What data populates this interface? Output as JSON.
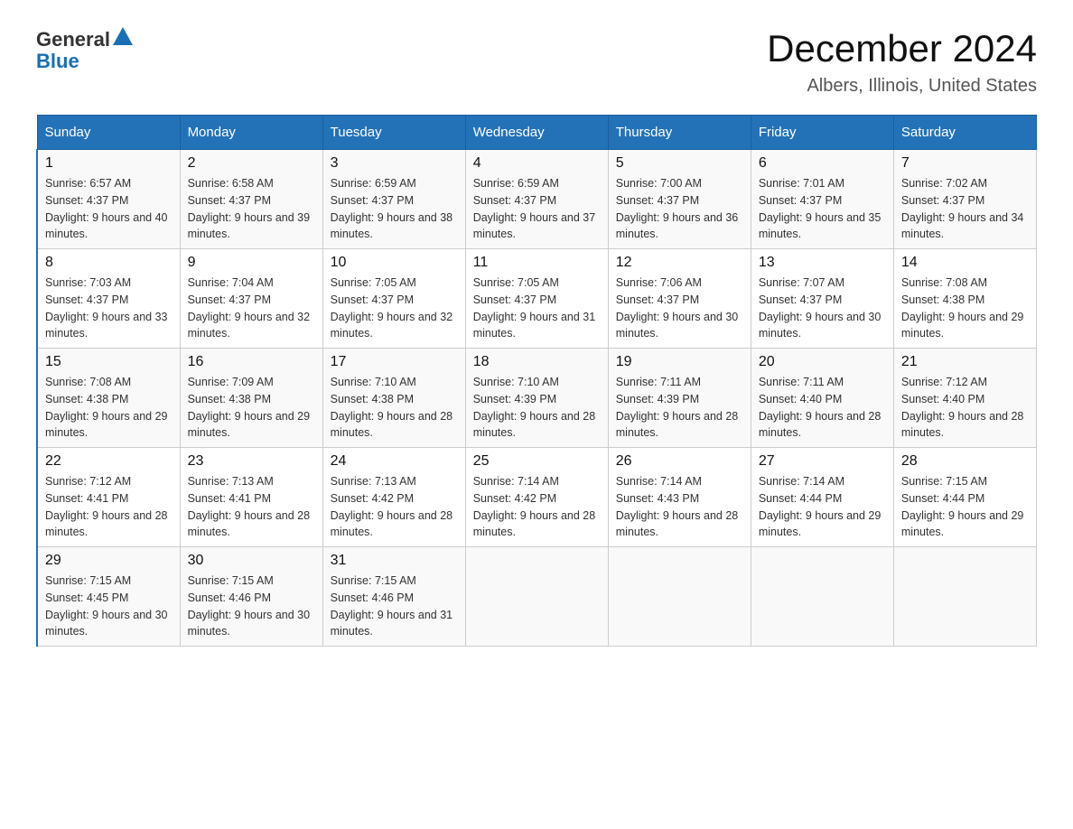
{
  "logo": {
    "text_general": "General",
    "text_blue": "Blue"
  },
  "header": {
    "title": "December 2024",
    "subtitle": "Albers, Illinois, United States"
  },
  "days_of_week": [
    "Sunday",
    "Monday",
    "Tuesday",
    "Wednesday",
    "Thursday",
    "Friday",
    "Saturday"
  ],
  "weeks": [
    [
      {
        "day": "1",
        "sunrise": "6:57 AM",
        "sunset": "4:37 PM",
        "daylight": "9 hours and 40 minutes."
      },
      {
        "day": "2",
        "sunrise": "6:58 AM",
        "sunset": "4:37 PM",
        "daylight": "9 hours and 39 minutes."
      },
      {
        "day": "3",
        "sunrise": "6:59 AM",
        "sunset": "4:37 PM",
        "daylight": "9 hours and 38 minutes."
      },
      {
        "day": "4",
        "sunrise": "6:59 AM",
        "sunset": "4:37 PM",
        "daylight": "9 hours and 37 minutes."
      },
      {
        "day": "5",
        "sunrise": "7:00 AM",
        "sunset": "4:37 PM",
        "daylight": "9 hours and 36 minutes."
      },
      {
        "day": "6",
        "sunrise": "7:01 AM",
        "sunset": "4:37 PM",
        "daylight": "9 hours and 35 minutes."
      },
      {
        "day": "7",
        "sunrise": "7:02 AM",
        "sunset": "4:37 PM",
        "daylight": "9 hours and 34 minutes."
      }
    ],
    [
      {
        "day": "8",
        "sunrise": "7:03 AM",
        "sunset": "4:37 PM",
        "daylight": "9 hours and 33 minutes."
      },
      {
        "day": "9",
        "sunrise": "7:04 AM",
        "sunset": "4:37 PM",
        "daylight": "9 hours and 32 minutes."
      },
      {
        "day": "10",
        "sunrise": "7:05 AM",
        "sunset": "4:37 PM",
        "daylight": "9 hours and 32 minutes."
      },
      {
        "day": "11",
        "sunrise": "7:05 AM",
        "sunset": "4:37 PM",
        "daylight": "9 hours and 31 minutes."
      },
      {
        "day": "12",
        "sunrise": "7:06 AM",
        "sunset": "4:37 PM",
        "daylight": "9 hours and 30 minutes."
      },
      {
        "day": "13",
        "sunrise": "7:07 AM",
        "sunset": "4:37 PM",
        "daylight": "9 hours and 30 minutes."
      },
      {
        "day": "14",
        "sunrise": "7:08 AM",
        "sunset": "4:38 PM",
        "daylight": "9 hours and 29 minutes."
      }
    ],
    [
      {
        "day": "15",
        "sunrise": "7:08 AM",
        "sunset": "4:38 PM",
        "daylight": "9 hours and 29 minutes."
      },
      {
        "day": "16",
        "sunrise": "7:09 AM",
        "sunset": "4:38 PM",
        "daylight": "9 hours and 29 minutes."
      },
      {
        "day": "17",
        "sunrise": "7:10 AM",
        "sunset": "4:38 PM",
        "daylight": "9 hours and 28 minutes."
      },
      {
        "day": "18",
        "sunrise": "7:10 AM",
        "sunset": "4:39 PM",
        "daylight": "9 hours and 28 minutes."
      },
      {
        "day": "19",
        "sunrise": "7:11 AM",
        "sunset": "4:39 PM",
        "daylight": "9 hours and 28 minutes."
      },
      {
        "day": "20",
        "sunrise": "7:11 AM",
        "sunset": "4:40 PM",
        "daylight": "9 hours and 28 minutes."
      },
      {
        "day": "21",
        "sunrise": "7:12 AM",
        "sunset": "4:40 PM",
        "daylight": "9 hours and 28 minutes."
      }
    ],
    [
      {
        "day": "22",
        "sunrise": "7:12 AM",
        "sunset": "4:41 PM",
        "daylight": "9 hours and 28 minutes."
      },
      {
        "day": "23",
        "sunrise": "7:13 AM",
        "sunset": "4:41 PM",
        "daylight": "9 hours and 28 minutes."
      },
      {
        "day": "24",
        "sunrise": "7:13 AM",
        "sunset": "4:42 PM",
        "daylight": "9 hours and 28 minutes."
      },
      {
        "day": "25",
        "sunrise": "7:14 AM",
        "sunset": "4:42 PM",
        "daylight": "9 hours and 28 minutes."
      },
      {
        "day": "26",
        "sunrise": "7:14 AM",
        "sunset": "4:43 PM",
        "daylight": "9 hours and 28 minutes."
      },
      {
        "day": "27",
        "sunrise": "7:14 AM",
        "sunset": "4:44 PM",
        "daylight": "9 hours and 29 minutes."
      },
      {
        "day": "28",
        "sunrise": "7:15 AM",
        "sunset": "4:44 PM",
        "daylight": "9 hours and 29 minutes."
      }
    ],
    [
      {
        "day": "29",
        "sunrise": "7:15 AM",
        "sunset": "4:45 PM",
        "daylight": "9 hours and 30 minutes."
      },
      {
        "day": "30",
        "sunrise": "7:15 AM",
        "sunset": "4:46 PM",
        "daylight": "9 hours and 30 minutes."
      },
      {
        "day": "31",
        "sunrise": "7:15 AM",
        "sunset": "4:46 PM",
        "daylight": "9 hours and 31 minutes."
      },
      null,
      null,
      null,
      null
    ]
  ]
}
